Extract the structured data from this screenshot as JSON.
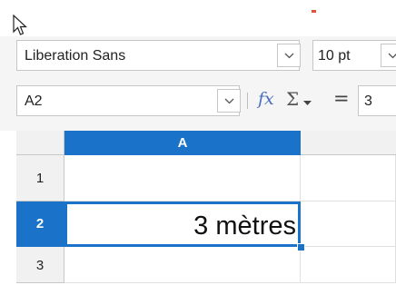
{
  "toolbar": {
    "font_name": "Liberation Sans",
    "font_size": "10 pt"
  },
  "formula_bar": {
    "name_box": "A2",
    "fx_label": "fx",
    "sigma_label": "Σ",
    "equals_label": "=",
    "input_value": "3"
  },
  "grid": {
    "column_headers": [
      "A"
    ],
    "row_headers": [
      "1",
      "2",
      "3"
    ],
    "cells": {
      "A2": "3 mètres"
    }
  },
  "colors": {
    "accent": "#1a73c8",
    "header_bg": "#f1f1f1"
  },
  "icons": [
    "cursor-arrow-icon",
    "chevron-down-icon",
    "fx-icon",
    "sigma-icon",
    "equals-icon"
  ]
}
